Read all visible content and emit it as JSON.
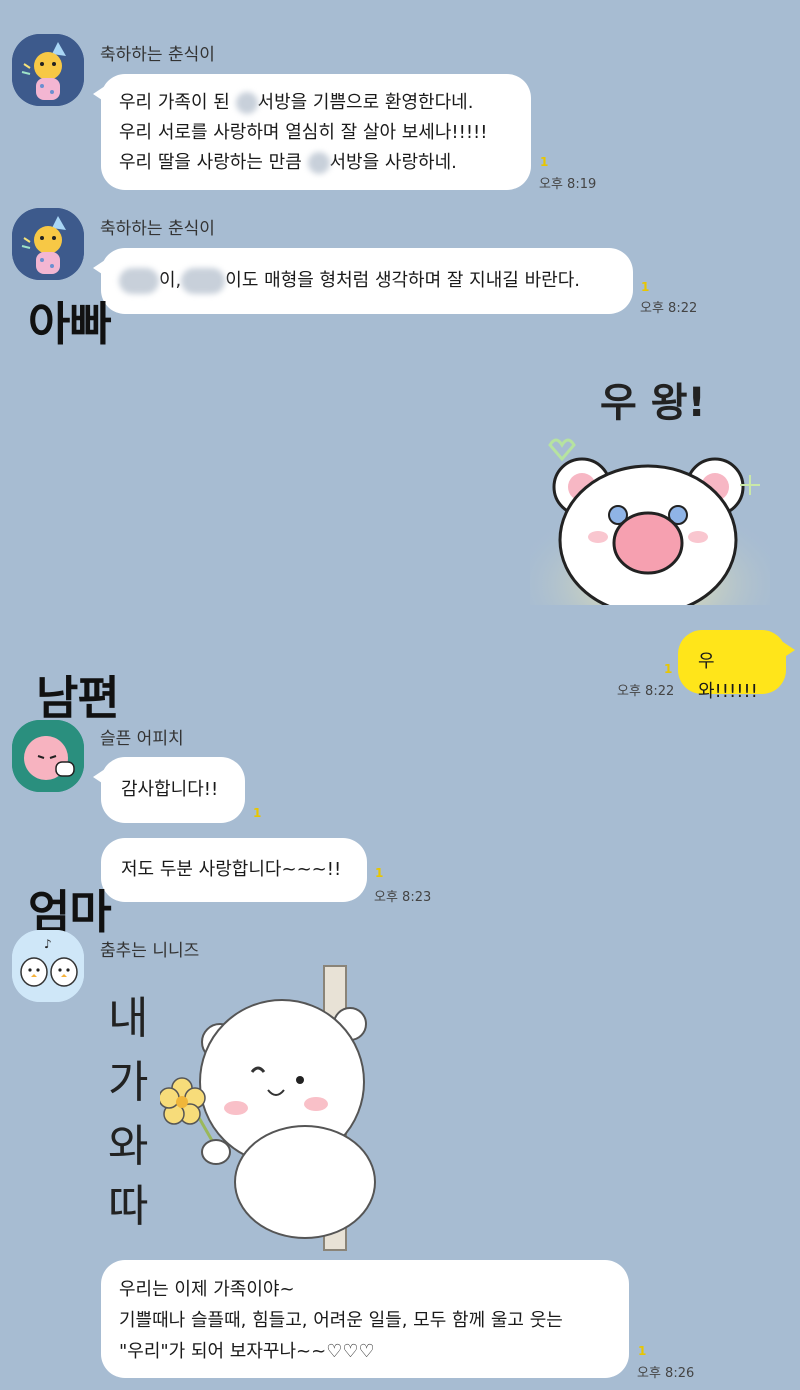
{
  "messages": {
    "m1": {
      "sender": "축하하는 춘식이",
      "line1a": "우리 가족이 된 ",
      "line1b": "서방을 기쁨으로 환영한다네.",
      "line2": "우리 서로를 사랑하며 열심히 잘 살아 보세나!!!!!",
      "line3a": "우리 딸을 사랑하는 만큼 ",
      "line3b": "서방을 사랑하네.",
      "read": "1",
      "time": "오후 8:19"
    },
    "m2": {
      "sender": "축하하는 춘식이",
      "texta": "이,",
      "textb": "이도 매형을 형처럼 생각하며 잘 지내길 바란다.",
      "read": "1",
      "time": "오후 8:22"
    },
    "m3": {
      "sticker_text": "우 왕!",
      "read": "1",
      "time": "오후 8:22"
    },
    "m4": {
      "text": "우와!!!!!!",
      "read": "1",
      "time": "오후 8:22"
    },
    "m5": {
      "sender": "슬픈 어피치",
      "text": "감사합니다!!",
      "read": "1"
    },
    "m6": {
      "text": "저도 두분 사랑합니다~~~!!",
      "read": "1",
      "time": "오후 8:23"
    },
    "m7": {
      "sender": "춤추는 니니즈",
      "sticker_chars": [
        "내",
        "가",
        "와",
        "따"
      ]
    },
    "m8": {
      "line1": "우리는 이제 가족이야~",
      "line2": "기쁠때나 슬플때, 힘들고, 어려운 일들, 모두 함께 울고 웃는",
      "line3": "\"우리\"가 되어 보자꾸나~~♡♡♡",
      "read": "1",
      "time": "오후 8:26"
    }
  },
  "labels": {
    "dad": "아빠",
    "husband": "남편",
    "mom": "엄마"
  },
  "colors": {
    "background": "#a7bcd2",
    "my_bubble": "#ffe51a",
    "other_bubble": "#ffffff",
    "read_count": "#e8c600"
  }
}
